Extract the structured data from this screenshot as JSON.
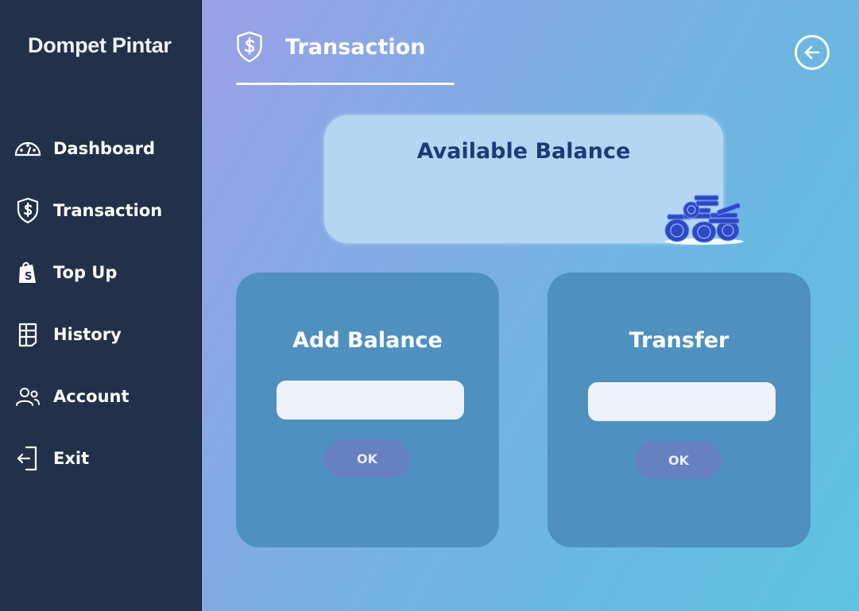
{
  "app": {
    "brand": "Dompet Pintar"
  },
  "sidebar": {
    "items": [
      {
        "label": "Dashboard",
        "icon": "dashboard-gauge-icon"
      },
      {
        "label": "Transaction",
        "icon": "shield-dollar-icon"
      },
      {
        "label": "Top Up",
        "icon": "shopping-bag-icon"
      },
      {
        "label": "History",
        "icon": "history-table-icon"
      },
      {
        "label": "Account",
        "icon": "users-icon"
      },
      {
        "label": "Exit",
        "icon": "exit-door-icon"
      }
    ]
  },
  "header": {
    "tab_label": "Transaction",
    "tab_icon": "shield-dollar-icon",
    "back_icon": "arrow-left-circle-icon"
  },
  "balance": {
    "title": "Available Balance",
    "illustration": "coin-stack-icon"
  },
  "add_balance": {
    "title": "Add Balance",
    "value": "",
    "placeholder": "",
    "button_label": "OK"
  },
  "transfer": {
    "title": "Transfer",
    "value": "",
    "placeholder": "",
    "button_label": "OK"
  },
  "colors": {
    "sidebar_bg": "#22314a",
    "panel_bg": "#4e91bf",
    "balance_card_bg": "#b4d6f1",
    "balance_title": "#1e3a78",
    "ok_button_bg": "#6780c0",
    "gradient_start": "#9aa0e6",
    "gradient_end": "#5ec3df"
  }
}
